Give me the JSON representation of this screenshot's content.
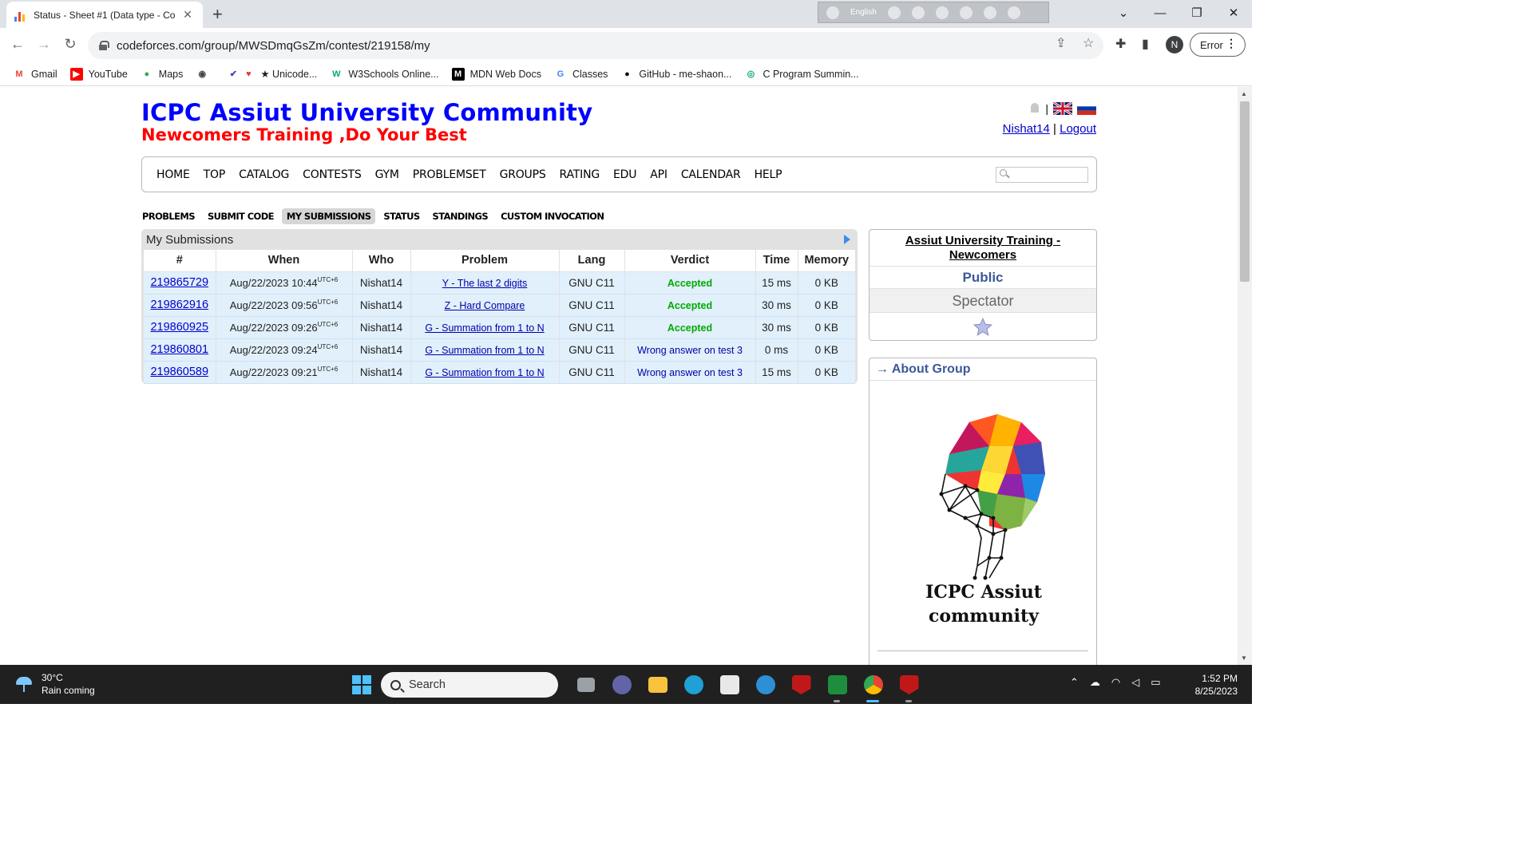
{
  "browser": {
    "tab_title": "Status - Sheet #1 (Data type - Co",
    "url": "codeforces.com/group/MWSDmqGsZm/contest/219158/my",
    "ime_label": "English",
    "profile_initial": "N",
    "error_label": "Error",
    "bookmarks": [
      {
        "label": "Gmail",
        "icon": "gmail-icon"
      },
      {
        "label": "YouTube",
        "icon": "youtube-icon"
      },
      {
        "label": "Maps",
        "icon": "maps-icon"
      },
      {
        "label": "",
        "icon": "globe-icon"
      },
      {
        "label": "★ Unicode...",
        "icon": "unicode-icon"
      },
      {
        "label": "W3Schools Online...",
        "icon": "w3schools-icon"
      },
      {
        "label": "MDN Web Docs",
        "icon": "mdn-icon"
      },
      {
        "label": "Classes",
        "icon": "google-icon"
      },
      {
        "label": "GitHub - me-shaon...",
        "icon": "github-icon"
      },
      {
        "label": "C Program Summin...",
        "icon": "chatgpt-icon"
      }
    ]
  },
  "site": {
    "title": "ICPC Assiut University Community",
    "subtitle": "Newcomers Training ,Do Your Best",
    "user": "Nishat14",
    "logout": "Logout",
    "separator": "|"
  },
  "main_menu": [
    "HOME",
    "TOP",
    "CATALOG",
    "CONTESTS",
    "GYM",
    "PROBLEMSET",
    "GROUPS",
    "RATING",
    "EDU",
    "API",
    "CALENDAR",
    "HELP"
  ],
  "contest_menu": [
    "PROBLEMS",
    "SUBMIT CODE",
    "MY SUBMISSIONS",
    "STATUS",
    "STANDINGS",
    "CUSTOM INVOCATION"
  ],
  "contest_menu_active": "MY SUBMISSIONS",
  "submissions": {
    "caption": "My Submissions",
    "columns": [
      "#",
      "When",
      "Who",
      "Problem",
      "Lang",
      "Verdict",
      "Time",
      "Memory"
    ],
    "tz": "UTC+6",
    "rows": [
      {
        "id": "219865729",
        "when": "Aug/22/2023 10:44",
        "who": "Nishat14",
        "problem": "Y - The last 2 digits",
        "lang": "GNU C11",
        "verdict": "Accepted",
        "ok": true,
        "time": "15 ms",
        "memory": "0 KB"
      },
      {
        "id": "219862916",
        "when": "Aug/22/2023 09:56",
        "who": "Nishat14",
        "problem": "Z - Hard Compare",
        "lang": "GNU C11",
        "verdict": "Accepted",
        "ok": true,
        "time": "30 ms",
        "memory": "0 KB"
      },
      {
        "id": "219860925",
        "when": "Aug/22/2023 09:26",
        "who": "Nishat14",
        "problem": "G - Summation from 1 to N",
        "lang": "GNU C11",
        "verdict": "Accepted",
        "ok": true,
        "time": "30 ms",
        "memory": "0 KB"
      },
      {
        "id": "219860801",
        "when": "Aug/22/2023 09:24",
        "who": "Nishat14",
        "problem": "G - Summation from 1 to N",
        "lang": "GNU C11",
        "verdict": "Wrong answer on test 3",
        "ok": false,
        "time": "0 ms",
        "memory": "0 KB"
      },
      {
        "id": "219860589",
        "when": "Aug/22/2023 09:21",
        "who": "Nishat14",
        "problem": "G - Summation from 1 to N",
        "lang": "GNU C11",
        "verdict": "Wrong answer on test 3",
        "ok": false,
        "time": "15 ms",
        "memory": "0 KB"
      }
    ]
  },
  "sidebar": {
    "group_title": "Assiut University Training - Newcomers",
    "visibility": "Public",
    "role": "Spectator",
    "about_title": "→ About Group",
    "logo_line1": "ICPC Assiut",
    "logo_line2": "community"
  },
  "taskbar": {
    "temp": "30°C",
    "weather": "Rain coming",
    "search": "Search",
    "time": "1:52 PM",
    "date": "8/25/2023"
  },
  "colors": {
    "title_blue": "#0000ff",
    "subtitle_red": "#ff0000",
    "accepted_green": "#00aa00",
    "wrong_blue": "#0000aa",
    "row_bg": "#e1f0fb"
  }
}
